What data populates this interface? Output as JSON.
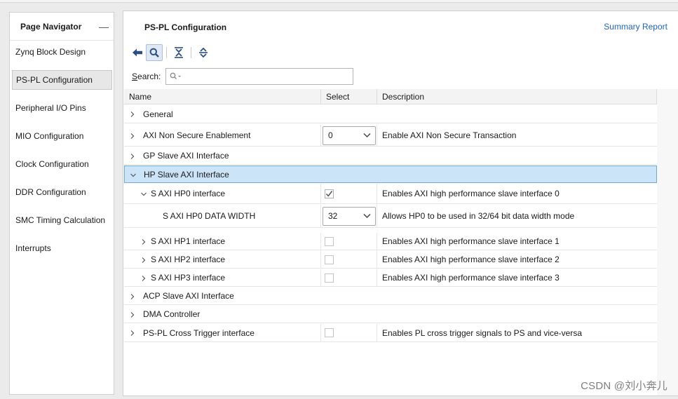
{
  "page_navigator": {
    "title": "Page Navigator",
    "minimize_icon": "minus-icon",
    "items": [
      {
        "label": "Zynq Block Design",
        "selected": false
      },
      {
        "label": "PS-PL Configuration",
        "selected": true
      },
      {
        "label": "Peripheral I/O Pins",
        "selected": false
      },
      {
        "label": "MIO Configuration",
        "selected": false
      },
      {
        "label": "Clock Configuration",
        "selected": false
      },
      {
        "label": "DDR Configuration",
        "selected": false
      },
      {
        "label": "SMC Timing Calculation",
        "selected": false
      },
      {
        "label": "Interrupts",
        "selected": false
      }
    ]
  },
  "main": {
    "title": "PS-PL Configuration",
    "summary_link": "Summary Report",
    "toolbar": [
      "back-arrow-icon",
      "search-icon",
      "collapse-all-icon",
      "expand-all-icon"
    ],
    "search": {
      "label_prefix": "S",
      "label_rest": "earch:",
      "value": ""
    }
  },
  "table": {
    "columns": [
      "Name",
      "Select",
      "Description"
    ],
    "rows": [
      {
        "name": "General",
        "level": 0,
        "expanded": false,
        "select_type": "none",
        "select_value": "",
        "description": ""
      },
      {
        "name": "AXI Non Secure Enablement",
        "level": 0,
        "expanded": false,
        "select_type": "dropdown",
        "select_value": "0",
        "description": "Enable AXI Non Secure Transaction"
      },
      {
        "name": "GP Slave AXI Interface",
        "level": 0,
        "expanded": false,
        "select_type": "none",
        "select_value": "",
        "description": ""
      },
      {
        "name": "HP Slave AXI Interface",
        "level": 0,
        "expanded": true,
        "selected": true,
        "select_type": "none",
        "select_value": "",
        "description": ""
      },
      {
        "name": "S AXI HP0 interface",
        "level": 1,
        "expanded": true,
        "select_type": "checkbox",
        "checked": true,
        "description": "Enables AXI high performance slave interface 0"
      },
      {
        "name": "S AXI HP0 DATA WIDTH",
        "level": 2,
        "expanded": null,
        "select_type": "dropdown",
        "select_value": "32",
        "description": "Allows HP0 to be used in 32/64 bit data width mode"
      },
      {
        "name": "S AXI HP1 interface",
        "level": 1,
        "expanded": false,
        "select_type": "checkbox",
        "checked": false,
        "description": "Enables AXI high performance slave interface 1"
      },
      {
        "name": "S AXI HP2 interface",
        "level": 1,
        "expanded": false,
        "select_type": "checkbox",
        "checked": false,
        "description": "Enables AXI high performance slave interface 2"
      },
      {
        "name": "S AXI HP3 interface",
        "level": 1,
        "expanded": false,
        "select_type": "checkbox",
        "checked": false,
        "description": "Enables AXI high performance slave interface 3"
      },
      {
        "name": "ACP Slave AXI Interface",
        "level": 0,
        "expanded": false,
        "select_type": "none",
        "select_value": "",
        "description": ""
      },
      {
        "name": "DMA Controller",
        "level": 0,
        "expanded": false,
        "select_type": "none",
        "select_value": "",
        "description": ""
      },
      {
        "name": "PS-PL Cross Trigger interface",
        "level": 0,
        "expanded": false,
        "select_type": "checkbox",
        "checked": false,
        "description": "Enables PL cross trigger signals to PS and vice-versa"
      }
    ]
  },
  "watermark": "CSDN @刘小奔儿",
  "colors": {
    "accent_link": "#1f63c6",
    "selection_bg": "#cce4f7",
    "selection_border": "#6fa9dc",
    "toolbar_icon": "#2a4f86"
  }
}
